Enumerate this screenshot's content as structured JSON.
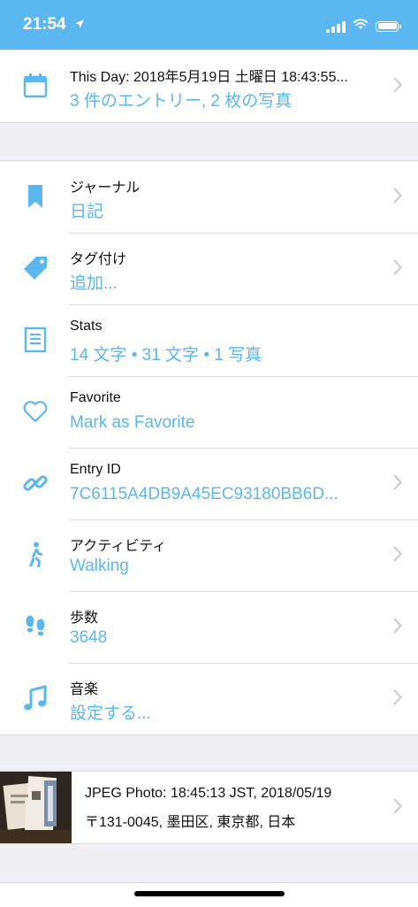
{
  "status_bar": {
    "time": "21:54",
    "location_arrow": "➤"
  },
  "this_day": {
    "title": "This Day: 2018年5月19日 土曜日 18:43:55...",
    "value": "3 件のエントリー, 2 枚の写真",
    "icon": "calendar-icon"
  },
  "rows": [
    {
      "title": "ジャーナル",
      "value": "日記",
      "icon": "bookmark-icon",
      "chevron": true
    },
    {
      "title": "タグ付け",
      "value": "追加...",
      "icon": "tag-icon",
      "chevron": true
    },
    {
      "title": "Stats",
      "value": "14 文字 • 31 文字 • 1 写真",
      "icon": "document-icon",
      "chevron": false
    },
    {
      "title": "Favorite",
      "value": "Mark as Favorite",
      "icon": "heart-icon",
      "chevron": false
    },
    {
      "title": "Entry ID",
      "value": "7C6115A4DB9A45EC93180BB6D...",
      "icon": "link-icon",
      "chevron": true
    },
    {
      "title": "アクティビティ",
      "value": "Walking",
      "icon": "walking-icon",
      "chevron": true
    },
    {
      "title": "歩数",
      "value": "3648",
      "icon": "footprints-icon",
      "chevron": true
    },
    {
      "title": "音楽",
      "value": "設定する...",
      "icon": "music-note-icon",
      "chevron": true
    }
  ],
  "photo": {
    "title": "JPEG Photo: 18:45:13 JST, 2018/05/19",
    "subtitle": "〒131-0045, 墨田区, 東京都, 日本"
  },
  "colors": {
    "accent": "#5bb7ef",
    "background": "#efeff4",
    "chevron": "#c7c7cc"
  }
}
